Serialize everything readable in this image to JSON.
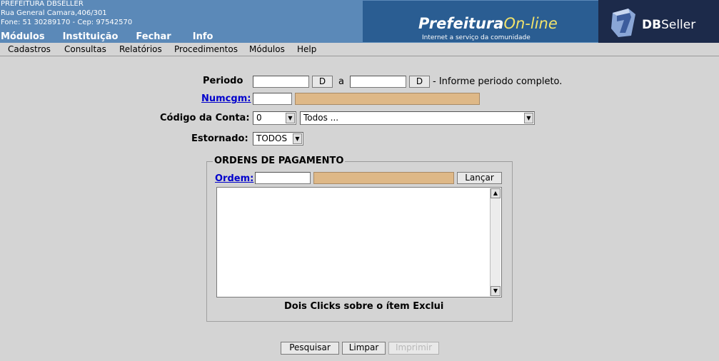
{
  "header": {
    "org_name": "PREFEITURA DBSELLER",
    "address": "Rua General Camara,406/301",
    "phone": "Fone: 51 30289170  -  Cep: 97542570",
    "top_menu": [
      "Módulos",
      "Instituição",
      "Fechar",
      "Info"
    ],
    "logo_title": "Prefeitura",
    "logo_title_accent": "On-line",
    "logo_subtitle": "Internet a serviço da comunidade",
    "dbseller_bold": "DB",
    "dbseller_rest": "Seller"
  },
  "menubar": [
    "Cadastros",
    "Consultas",
    "Relatórios",
    "Procedimentos",
    "Módulos",
    "Help"
  ],
  "form": {
    "periodo_label": "Periodo",
    "periodo_start_value": "",
    "periodo_end_value": "",
    "date_button_label": "D",
    "periodo_sep": "a",
    "periodo_hint": "- Informe periodo completo.",
    "numcgm_label": "Numcgm:",
    "numcgm_value": "",
    "numcgm_name_value": "",
    "conta_label": "Código da Conta:",
    "conta_code_selected": "0",
    "conta_desc_selected": "Todos ...",
    "estornado_label": "Estornado:",
    "estornado_selected": "TODOS"
  },
  "ordens": {
    "legend": "ORDENS DE PAGAMENTO",
    "ordem_label": "Ordem:",
    "ordem_value": "",
    "ordem_desc_value": "",
    "lancar_label": "Lançar",
    "hint": "Dois Clicks sobre o ítem Exclui"
  },
  "actions": {
    "pesquisar_label": "Pesquisar",
    "limpar_label": "Limpar",
    "imprimir_label": "Imprimir"
  },
  "colors": {
    "header_bg": "#5b89b8",
    "logo_bg": "#2a5d92",
    "dbseller_bg": "#1c2a4a",
    "readonly_bg": "#deb887",
    "page_bg": "#d4d4d4"
  },
  "icons": {
    "dbseller_logo": "dbseller-logo-icon"
  }
}
